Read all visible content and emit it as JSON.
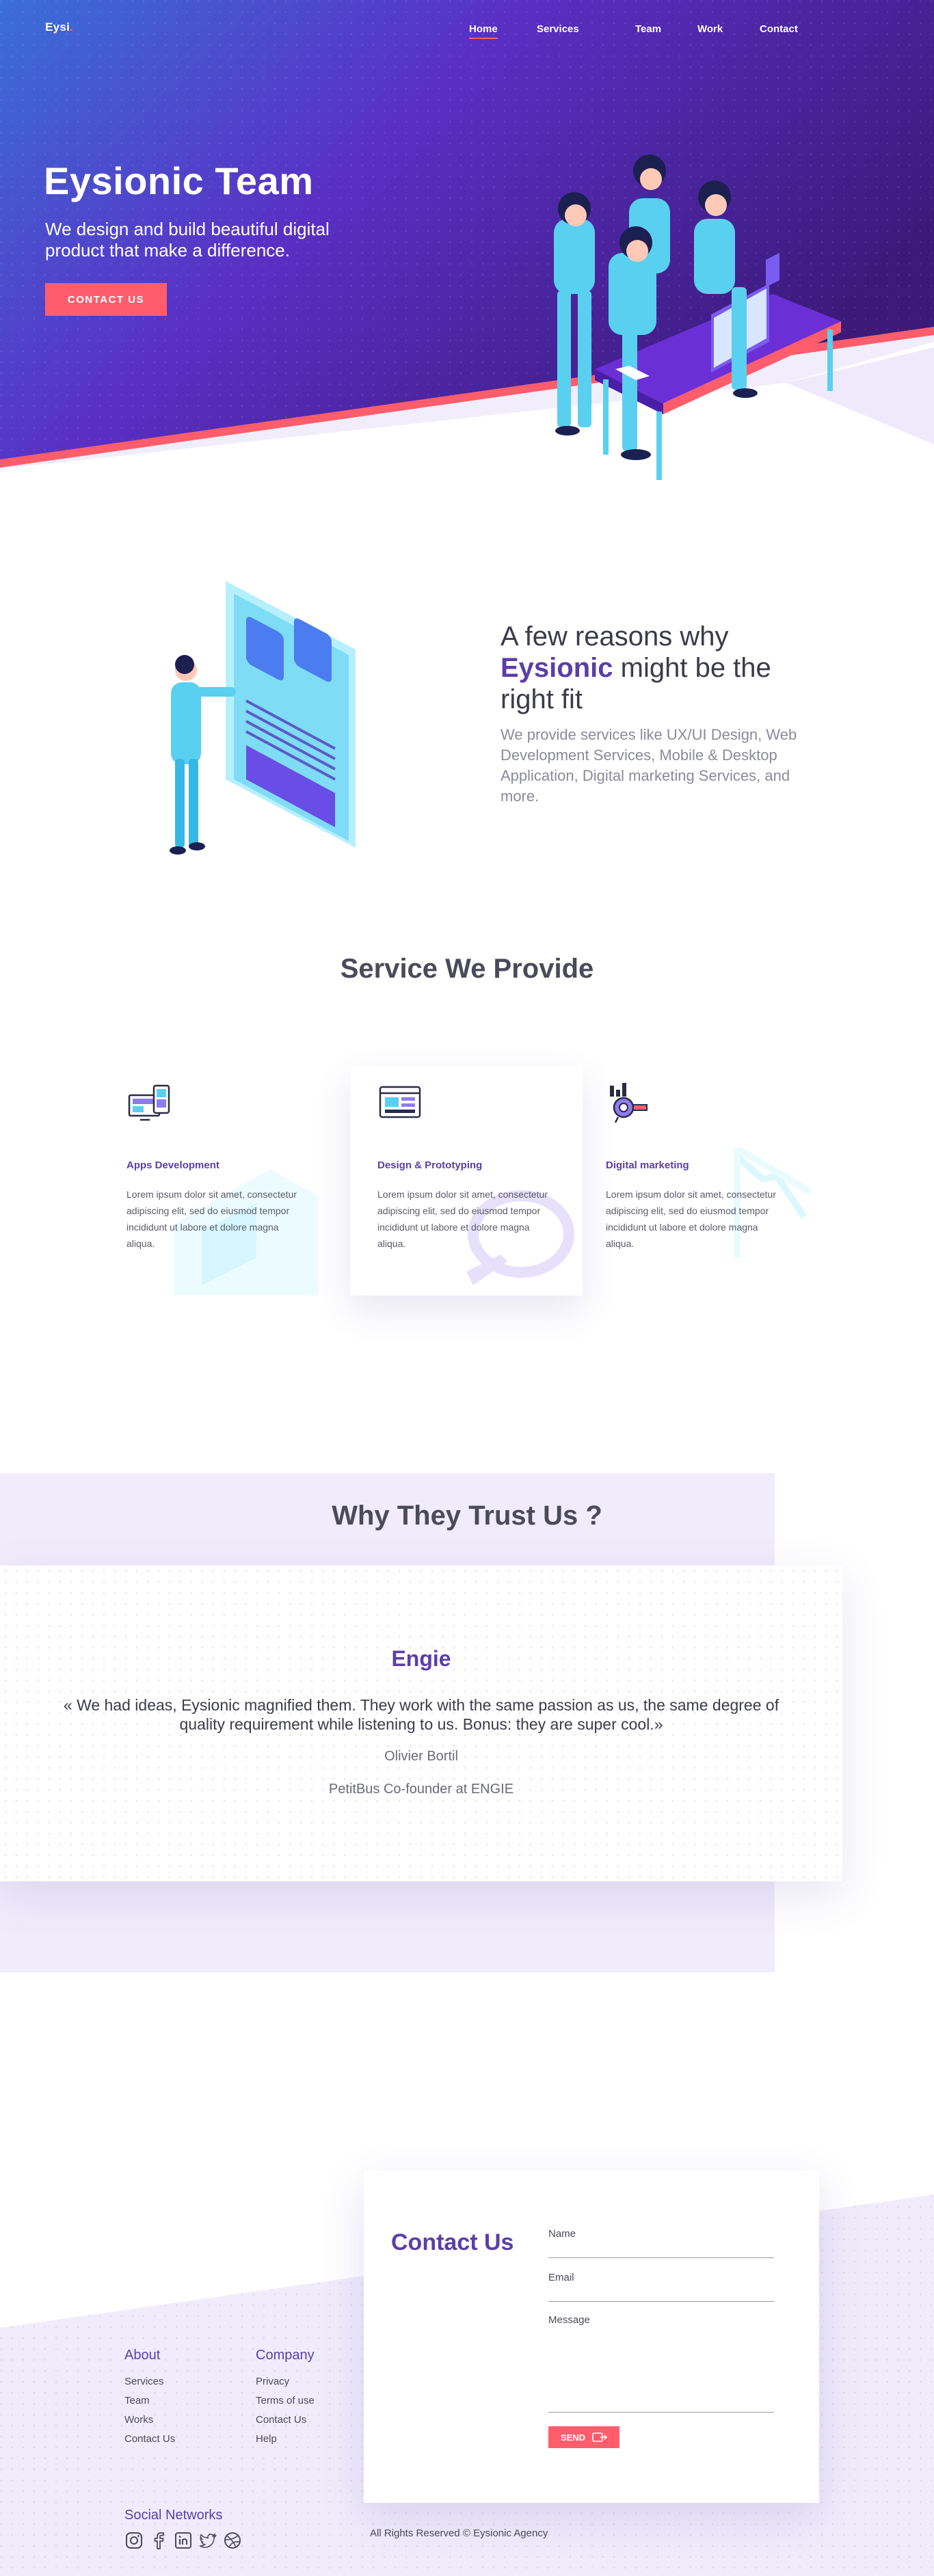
{
  "colors": {
    "purple": "#5b3ea8",
    "accent": "#ff5d6c",
    "hero_gradient_start": "#3a6fd8",
    "hero_gradient_end": "#3b1a7a"
  },
  "nav": {
    "logo_text": "Eysi",
    "logo_dot": ".",
    "links": [
      "Home",
      "Services",
      "Team",
      "Work",
      "Contact"
    ],
    "active": "Home"
  },
  "hero": {
    "title": "Eysionic Team",
    "subtitle": "We design and build beautiful digital product that make a difference.",
    "cta": "CONTACT US"
  },
  "reasons": {
    "title_before": "A few reasons why",
    "title_brand": "Eysionic",
    "title_after": "might be the right fit",
    "description": "We provide services like UX/UI Design, Web Development Services, Mobile & Desktop Application, Digital marketing Services, and more."
  },
  "services": {
    "title": "Service We Provide",
    "items": [
      {
        "name": "Apps Development",
        "icon": "devices-icon",
        "text": "Lorem ipsum dolor sit amet, consectetur adipiscing elit, sed do eiusmod tempor incididunt ut labore et dolore magna aliqua."
      },
      {
        "name": "Design & Prototyping",
        "icon": "design-window-icon",
        "text": "Lorem ipsum dolor sit amet, consectetur adipiscing elit, sed do eiusmod tempor incididunt ut labore et dolore magna aliqua."
      },
      {
        "name": "Digital marketing",
        "icon": "marketing-icon",
        "text": "Lorem ipsum dolor sit amet, consectetur adipiscing elit, sed do eiusmod tempor incididunt ut labore et dolore magna aliqua."
      }
    ]
  },
  "trust": {
    "title": "Why They Trust Us ?",
    "company": "Engie",
    "quote": "« We had ideas, Eysionic magnified them. They work with the same passion as us, the same degree of quality requirement while listening to us. Bonus: they are super cool.»",
    "author": "Olivier Bortil",
    "role": "PetitBus Co-founder at ENGIE"
  },
  "footer": {
    "about": {
      "heading": "About",
      "links": [
        "Services",
        "Team",
        "Works",
        "Contact Us"
      ]
    },
    "company": {
      "heading": "Company",
      "links": [
        "Privacy",
        "Terms  of use",
        "Contact Us",
        "Help"
      ]
    },
    "social_heading": "Social Networks",
    "socials": [
      "instagram-icon",
      "facebook-icon",
      "linkedin-icon",
      "twitter-icon",
      "dribbble-icon"
    ],
    "copyright": "All Rights Reserved © Eysionic Agency"
  },
  "contact": {
    "title": "Contact Us",
    "name_label": "Name",
    "email_label": "Email",
    "message_label": "Message",
    "send_label": "SEND"
  }
}
